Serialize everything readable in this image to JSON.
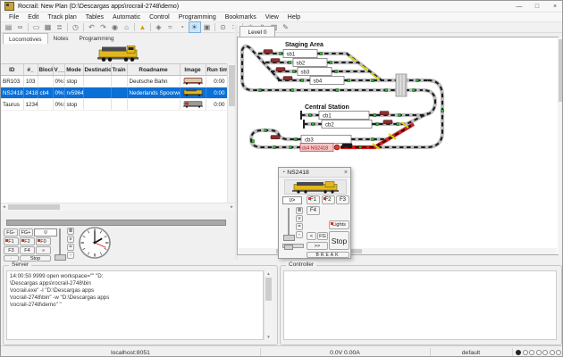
{
  "window": {
    "title": "Rocrail: New Plan (D:\\Descargas apps\\rocrail-2748\\demo)",
    "minimize": "—",
    "maximize": "□",
    "close": "×"
  },
  "menu": {
    "items": [
      "File",
      "Edit",
      "Track plan",
      "Tables",
      "Automatic",
      "Control",
      "Programming",
      "Bookmarks",
      "View",
      "Help"
    ]
  },
  "toolbar": {
    "icons": [
      {
        "name": "save",
        "glyph": "▤"
      },
      {
        "name": "connect",
        "glyph": "∞"
      },
      {
        "name": "open",
        "glyph": "▭"
      },
      {
        "name": "save-as",
        "glyph": "▦"
      },
      {
        "name": "print",
        "glyph": "≣"
      },
      {
        "name": "power",
        "glyph": "◷"
      },
      {
        "name": "undo",
        "glyph": "↶"
      },
      {
        "name": "redo",
        "glyph": "↷"
      },
      {
        "name": "record",
        "glyph": "◉"
      },
      {
        "name": "home",
        "glyph": "⌂"
      },
      {
        "name": "warning",
        "glyph": "▲"
      },
      {
        "name": "lock",
        "glyph": "◈"
      },
      {
        "name": "wifi",
        "glyph": "≈"
      },
      {
        "name": "clock",
        "glyph": "◔"
      },
      {
        "name": "power-on",
        "glyph": "☀"
      },
      {
        "name": "monitor",
        "glyph": "▣"
      },
      {
        "name": "search",
        "glyph": "⊙"
      },
      {
        "name": "fullscreen",
        "glyph": "∷"
      },
      {
        "name": "settings",
        "glyph": "✳"
      },
      {
        "name": "document",
        "glyph": "▯"
      },
      {
        "name": "copy",
        "glyph": "▥"
      },
      {
        "name": "edit",
        "glyph": "✎"
      }
    ]
  },
  "tabs": {
    "items": [
      "Locomotives",
      "Notes",
      "Programming"
    ]
  },
  "table": {
    "headers": [
      "ID",
      "#_",
      "Block",
      "V__",
      "Mode",
      "Destination",
      "Train",
      "Roadname",
      "Image",
      "Run time"
    ],
    "rows": [
      {
        "id": "BR103",
        "num": "103",
        "block": "",
        "v": "0%>",
        "mode": "stop",
        "dest": "",
        "train": "",
        "road": "Deutsche Bahn",
        "runtime": "0:00"
      },
      {
        "id": "NS2418",
        "num": "2418",
        "block": "cb4",
        "v": "0%>",
        "mode": "rv5964",
        "dest": "",
        "train": "",
        "road": "Nederlands Spoorwegen",
        "runtime": "0:00"
      },
      {
        "id": "Taurus",
        "num": "1234",
        "block": "",
        "v": "0%>",
        "mode": "stop",
        "dest": "",
        "train": "",
        "road": "",
        "runtime": "0:00"
      }
    ]
  },
  "mini": {
    "fg_minus": "FG-",
    "fg_plus": "FG+",
    "value": "0",
    "f1": "F1",
    "f2": "F2",
    "f0": "F0",
    "f3": "F3",
    "f4": "F4",
    "ff": "»",
    "dir": "·",
    "stop": "Stop",
    "presets": [
      "≣",
      "≡",
      "=",
      "-"
    ]
  },
  "plan": {
    "tab": "Level 0",
    "staging": "Staging Area",
    "central": "Central Station",
    "sb1": "sb1",
    "sb2": "sb2",
    "sb3": "sb3",
    "sb4": "sb4",
    "cb1": "cb1",
    "cb2": "cb2",
    "cb3": "cb3",
    "cb4": "cb4 NS2418"
  },
  "dialog": {
    "icon": "◔",
    "title": "NS2418",
    "close": "×",
    "speed": "0>",
    "f1": "F1",
    "f2": "F2",
    "f3": "F3",
    "f4": "F4",
    "lights": "Lights",
    "prev": "<",
    "fg": "FG",
    "next": ">>",
    "stop": "Stop",
    "brk": "BREAK",
    "presets": [
      "≣",
      "≡",
      "=",
      "-"
    ]
  },
  "server": {
    "label": "Server",
    "log": "14:00:50 9999 open workspace=\"\" \"D:\n\\Descargas apps\\rocrail-2748\\bin\n\\rocrail.exe\" -l \"D:\\Descargas apps\n\\rocrail-2748\\bin\" -w \"D:\\Descargas apps\n\\rocrail-2748\\demo\" \""
  },
  "controller": {
    "label": "Controller"
  },
  "status": {
    "host": "localhost:8051",
    "power": "0.0V 0.00A",
    "profile": "default"
  },
  "glyphs": {
    "up": "▲",
    "down": "▼",
    "left": "◄",
    "right": "►"
  },
  "colors": {
    "selection": "#0a6fd6",
    "route": "#cc2222",
    "sensor": "#2db82d",
    "occupied_bg": "#f3c6c6",
    "occupied_text": "#a01010",
    "switch": "#d6d600"
  }
}
